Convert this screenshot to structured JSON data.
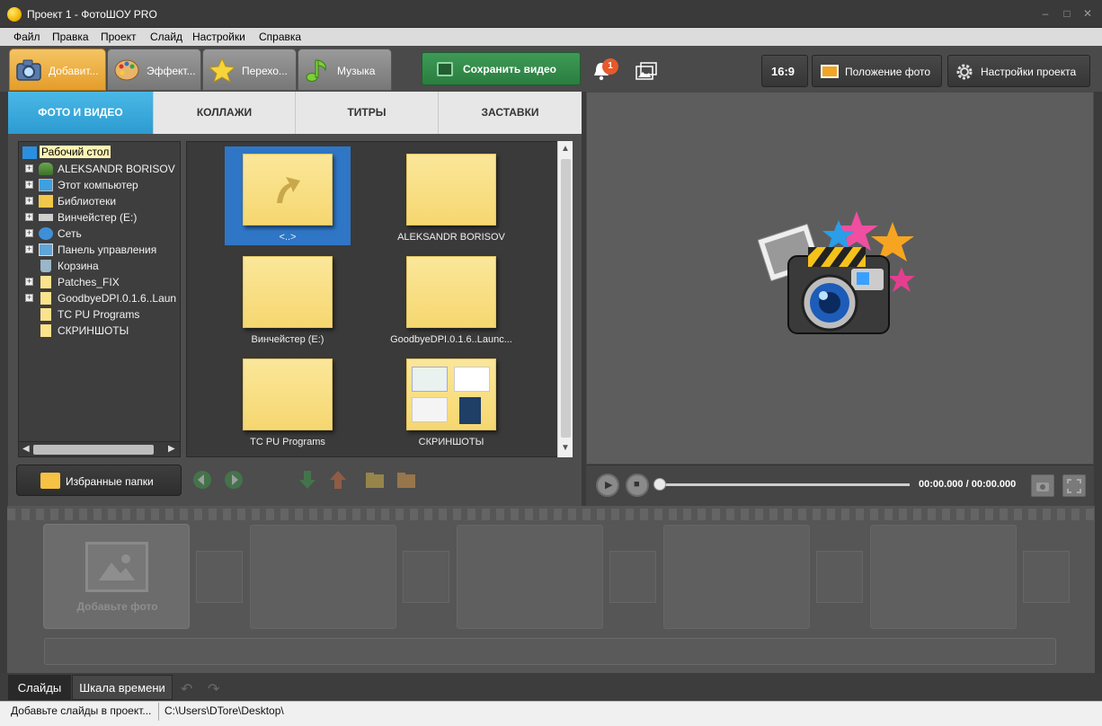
{
  "window": {
    "title": "Проект 1 - ФотоШОУ PRO",
    "minimize": "–",
    "maximize": "□",
    "close": "✕"
  },
  "menu": [
    "Файл",
    "Правка",
    "Проект",
    "Слайд",
    "Настройки",
    "Справка"
  ],
  "main_tabs": [
    {
      "label": "Добавит...",
      "icon": "camera-icon",
      "active": true
    },
    {
      "label": "Эффект...",
      "icon": "palette-icon",
      "active": false
    },
    {
      "label": "Перехо...",
      "icon": "star-icon",
      "active": false
    },
    {
      "label": "Музыка",
      "icon": "music-note-icon",
      "active": false
    }
  ],
  "save_button": "Сохранить видео",
  "notifications": {
    "count": "1"
  },
  "preview_toolbar": {
    "aspect": "16:9",
    "photo_position": "Положение фото",
    "project_settings": "Настройки проекта"
  },
  "sub_tabs": [
    "ФОТО И ВИДЕО",
    "КОЛЛАЖИ",
    "ТИТРЫ",
    "ЗАСТАВКИ"
  ],
  "tree": {
    "root": "Рабочий стол",
    "items": [
      {
        "label": "ALEKSANDR BORISOV",
        "icon": "user-icon",
        "expandable": true
      },
      {
        "label": "Этот компьютер",
        "icon": "computer-icon",
        "expandable": true
      },
      {
        "label": "Библиотеки",
        "icon": "library-icon",
        "expandable": true
      },
      {
        "label": "Винчейстер (E:)",
        "icon": "drive-icon",
        "expandable": true
      },
      {
        "label": "Сеть",
        "icon": "network-icon",
        "expandable": true
      },
      {
        "label": "Панель управления",
        "icon": "control-panel-icon",
        "expandable": true
      },
      {
        "label": "Корзина",
        "icon": "recycle-bin-icon",
        "expandable": false
      },
      {
        "label": "Patches_FIX",
        "icon": "folder-icon",
        "expandable": true
      },
      {
        "label": "GoodbyeDPI.0.1.6..Laun",
        "icon": "folder-icon",
        "expandable": true
      },
      {
        "label": "TC PU Programs",
        "icon": "folder-icon",
        "expandable": false
      },
      {
        "label": "СКРИНШОТЫ",
        "icon": "folder-icon",
        "expandable": false
      }
    ]
  },
  "grid": [
    {
      "label": "<..>",
      "type": "up",
      "selected": true
    },
    {
      "label": "ALEKSANDR BORISOV",
      "type": "folder",
      "selected": false
    },
    {
      "label": "Винчейстер (E:)",
      "type": "folder",
      "selected": false
    },
    {
      "label": "GoodbyeDPI.0.1.6..Launc...",
      "type": "folder",
      "selected": false
    },
    {
      "label": "TC PU Programs",
      "type": "folder",
      "selected": false
    },
    {
      "label": "СКРИНШОТЫ",
      "type": "thumbnail",
      "selected": false
    }
  ],
  "favorites_button": "Избранные папки",
  "player": {
    "timecode": "00:00.000 / 00:00.000"
  },
  "timeline": {
    "add_photo": "Добавьте фото"
  },
  "bottom_tabs": [
    "Слайды",
    "Шкала времени"
  ],
  "status": {
    "left": "Добавьте слайды в проект...",
    "path": "C:\\Users\\DTore\\Desktop\\"
  },
  "colors": {
    "accent_orange": "#e59d2a",
    "accent_blue": "#2c9bd0",
    "save_green": "#2b7d40",
    "selection_blue": "#2f76c6"
  }
}
